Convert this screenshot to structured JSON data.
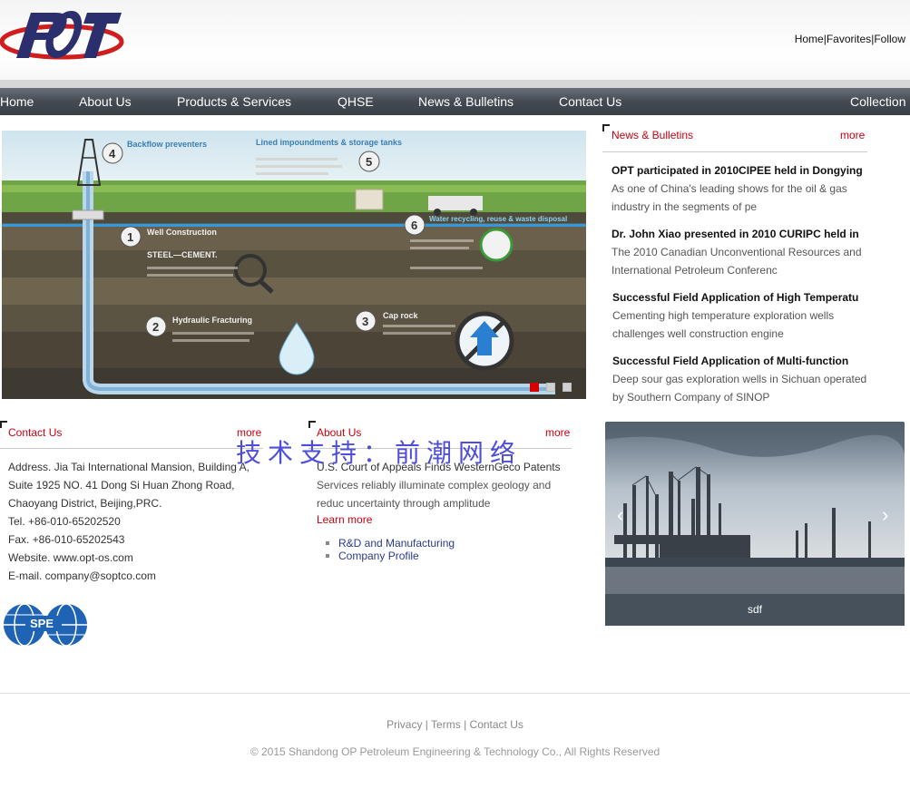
{
  "header": {
    "logo_text": "OPT",
    "toplinks": [
      "Home",
      "Favorites",
      "Follow"
    ],
    "separator": "|"
  },
  "nav": {
    "items": [
      "Home",
      "About Us",
      "Products & Services",
      "QHSE",
      "News & Bulletins",
      "Contact Us",
      "Collection"
    ]
  },
  "banner": {
    "labels": {
      "backflow": "Backflow preventers",
      "impoundments": "Lined impoundments & storage tanks",
      "well": "Well Construction",
      "fracturing": "Hydraulic Fracturing",
      "caprock": "Cap rock",
      "recycling": "Water recycling, reuse & waste disposal",
      "steel": "STEEL—CEMENT."
    },
    "numbers": [
      "1",
      "2",
      "3",
      "4",
      "5",
      "6"
    ],
    "active_slide": 1
  },
  "news": {
    "heading": "News & Bulletins",
    "more": "more",
    "items": [
      {
        "title": "OPT participated in 2010CIPEE held in Dongying",
        "desc": "As one of China's leading shows for the oil & gas industry in the segments of pe"
      },
      {
        "title": "Dr. John Xiao presented in 2010 CURIPC held in",
        "desc": "The 2010 Canadian Unconventional Resources and International Petroleum Conferenc"
      },
      {
        "title": "Successful Field Application of High Temperatu",
        "desc": "Cementing high temperature exploration wells challenges well construction engine"
      },
      {
        "title": "Successful Field Application of Multi-function",
        "desc": "Deep sour gas exploration wells in Sichuan operated by Southern Company of SINOP"
      }
    ]
  },
  "contact": {
    "heading": "Contact Us",
    "more": "more",
    "lines": [
      "Address. Jia Tai International Mansion, Building A,",
      "Suite 1925 NO. 41 Dong Si Huan Zhong Road,",
      "Chaoyang District, Beijing,PRC.",
      "Tel. +86-010-65202520",
      "Fax. +86-010-65202543",
      "Website. www.opt-os.com",
      "E-mail. company@soptco.com"
    ],
    "logo_text": "SPE International"
  },
  "about": {
    "heading": "About Us",
    "more": "more",
    "title": "U.S. Court of Appeals Finds WesternGeco Patents",
    "desc": "Services reliably illuminate complex geology and reduc uncertainty through amplitude",
    "learn_more": "Learn more",
    "links": [
      "R&D and Manufacturing",
      "Company Profile"
    ]
  },
  "watermark": "技术支持：前潮网络",
  "photo": {
    "caption": "sdf"
  },
  "footer": {
    "links": [
      "Privacy",
      "Terms",
      "Contact Us"
    ],
    "separator": "|",
    "copyright": "© 2015 Shandong OP Petroleum Engineering & Technology Co., All Rights Reserved"
  },
  "colors": {
    "accent_red": "#c8000f",
    "nav_dark": "#434a52",
    "logo_blue": "#2b2f6e",
    "logo_red": "#d01d1d"
  }
}
